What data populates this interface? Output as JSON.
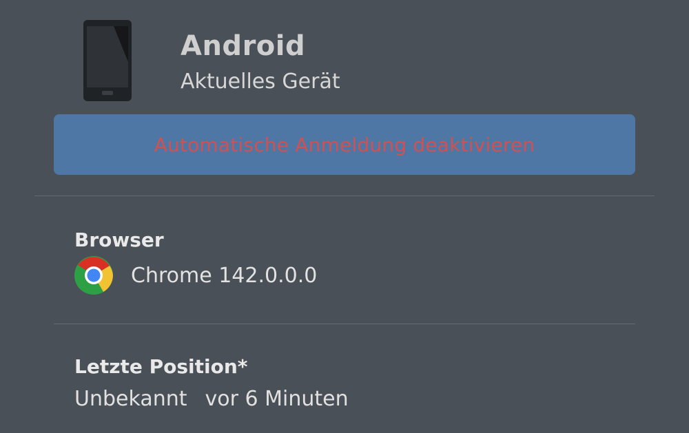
{
  "device": {
    "name": "Android",
    "subtitle": "Aktuelles Gerät",
    "icon": "smartphone-icon"
  },
  "actions": {
    "disable_autologin_label": "Automatische Anmeldung deaktivieren"
  },
  "browser": {
    "title": "Browser",
    "icon": "chrome-icon",
    "value": "Chrome 142.0.0.0"
  },
  "last_position": {
    "title": "Letzte Position*",
    "location": "Unbekannt",
    "time": "vor 6 Minuten"
  },
  "colors": {
    "background": "#4a5057",
    "button_background": "#4f77a6",
    "button_text": "#d05152"
  }
}
